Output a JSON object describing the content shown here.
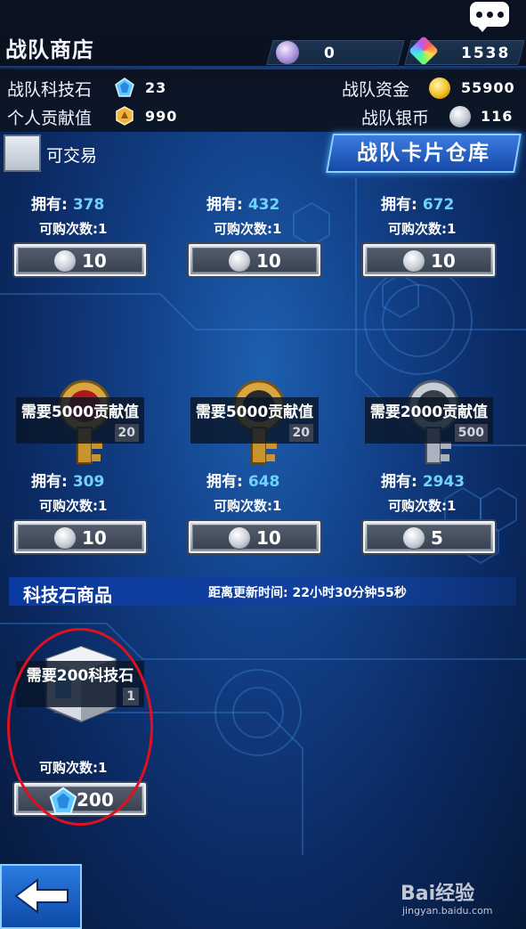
{
  "header": {
    "title": "战队商店",
    "currency_1": {
      "icon": "purple-crystal-icon",
      "value": "0"
    },
    "currency_2": {
      "icon": "rainbow-gem-icon",
      "value": "1538"
    }
  },
  "stats": {
    "tech_stone_label": "战队科技石",
    "tech_stone_value": "23",
    "contribution_label": "个人贡献值",
    "contribution_value": "990",
    "funds_label": "战队资金",
    "funds_value": "55900",
    "silver_label": "战队银币",
    "silver_value": "116"
  },
  "filter": {
    "tradable_label": "可交易"
  },
  "warehouse_button": "战队卡片仓库",
  "row1": [
    {
      "owned_label": "拥有:",
      "owned": "378",
      "limit": "可购次数:1",
      "price": "10"
    },
    {
      "owned_label": "拥有:",
      "owned": "432",
      "limit": "可购次数:1",
      "price": "10"
    },
    {
      "owned_label": "拥有:",
      "owned": "672",
      "limit": "可购次数:1",
      "price": "10"
    }
  ],
  "row2": [
    {
      "req": "需要5000贡献值",
      "count": "20",
      "owned_label": "拥有:",
      "owned": "309",
      "limit": "可购次数:1",
      "price": "10",
      "key_color": "#b01818"
    },
    {
      "req": "需要5000贡献值",
      "count": "20",
      "owned_label": "拥有:",
      "owned": "648",
      "limit": "可购次数:1",
      "price": "10",
      "key_color": "#2a2a2a"
    },
    {
      "req": "需要2000贡献值",
      "count": "500",
      "owned_label": "拥有:",
      "owned": "2943",
      "limit": "可购次数:1",
      "price": "5",
      "key_color": "#3a3f48"
    }
  ],
  "tech_section": {
    "title": "科技石商品",
    "refresh": "距离更新时间: 22小时30分钟55秒",
    "item": {
      "req": "需要200科技石",
      "count": "1",
      "limit": "可购次数:1",
      "price": "200"
    }
  },
  "watermark": {
    "text": "Bai经验",
    "url": "jingyan.baidu.com"
  },
  "colors": {
    "accent": "#6fd3ff",
    "highlight": "#e01020"
  }
}
